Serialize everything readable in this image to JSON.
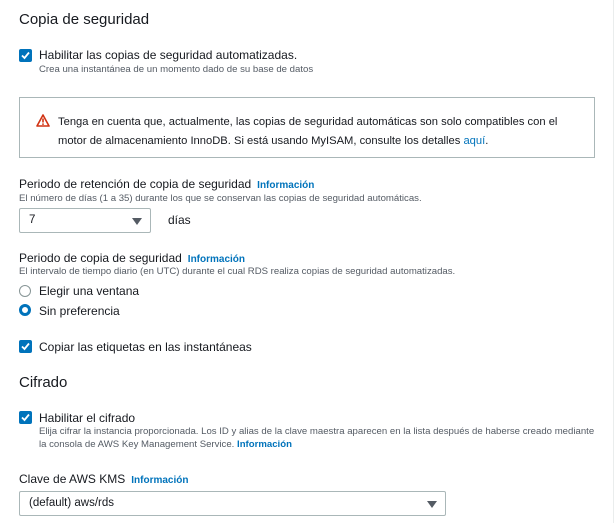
{
  "backup": {
    "title": "Copia de seguridad",
    "auto_backups_label": "Habilitar las copias de seguridad automatizadas.",
    "auto_backups_desc": "Crea una instantánea de un momento dado de su base de datos",
    "alert_text": "Tenga en cuenta que, actualmente, las copias de seguridad automáticas son solo compatibles con el motor de almacenamiento InnoDB. Si está usando MyISAM, consulte los detalles ",
    "alert_link": "aquí",
    "alert_end": ".",
    "retention_label": "Periodo de retención de copia de seguridad",
    "retention_info": "Información",
    "retention_desc": "El número de días (1 a 35) durante los que se conservan las copias de seguridad automáticas.",
    "retention_value": "7",
    "retention_unit": "días",
    "window_label": "Periodo de copia de seguridad",
    "window_info": "Información",
    "window_desc": "El intervalo de tiempo diario (en UTC) durante el cual RDS realiza copias de seguridad automatizadas.",
    "window_option_1": "Elegir una ventana",
    "window_option_2": "Sin preferencia",
    "copy_tags_label": "Copiar las etiquetas en las instantáneas"
  },
  "encryption": {
    "title": "Cifrado",
    "enable_label": "Habilitar el cifrado",
    "enable_desc": "Elija cifrar la instancia proporcionada. Los ID y alias de la clave maestra aparecen en la lista después de haberse creado mediante la consola de AWS Key Management Service.",
    "enable_desc_link": "Información",
    "kms_label": "Clave de AWS KMS",
    "kms_info": "Información",
    "kms_value": "(default) aws/rds"
  },
  "colors": {
    "accent": "#0073bb",
    "warning": "#d13212"
  }
}
